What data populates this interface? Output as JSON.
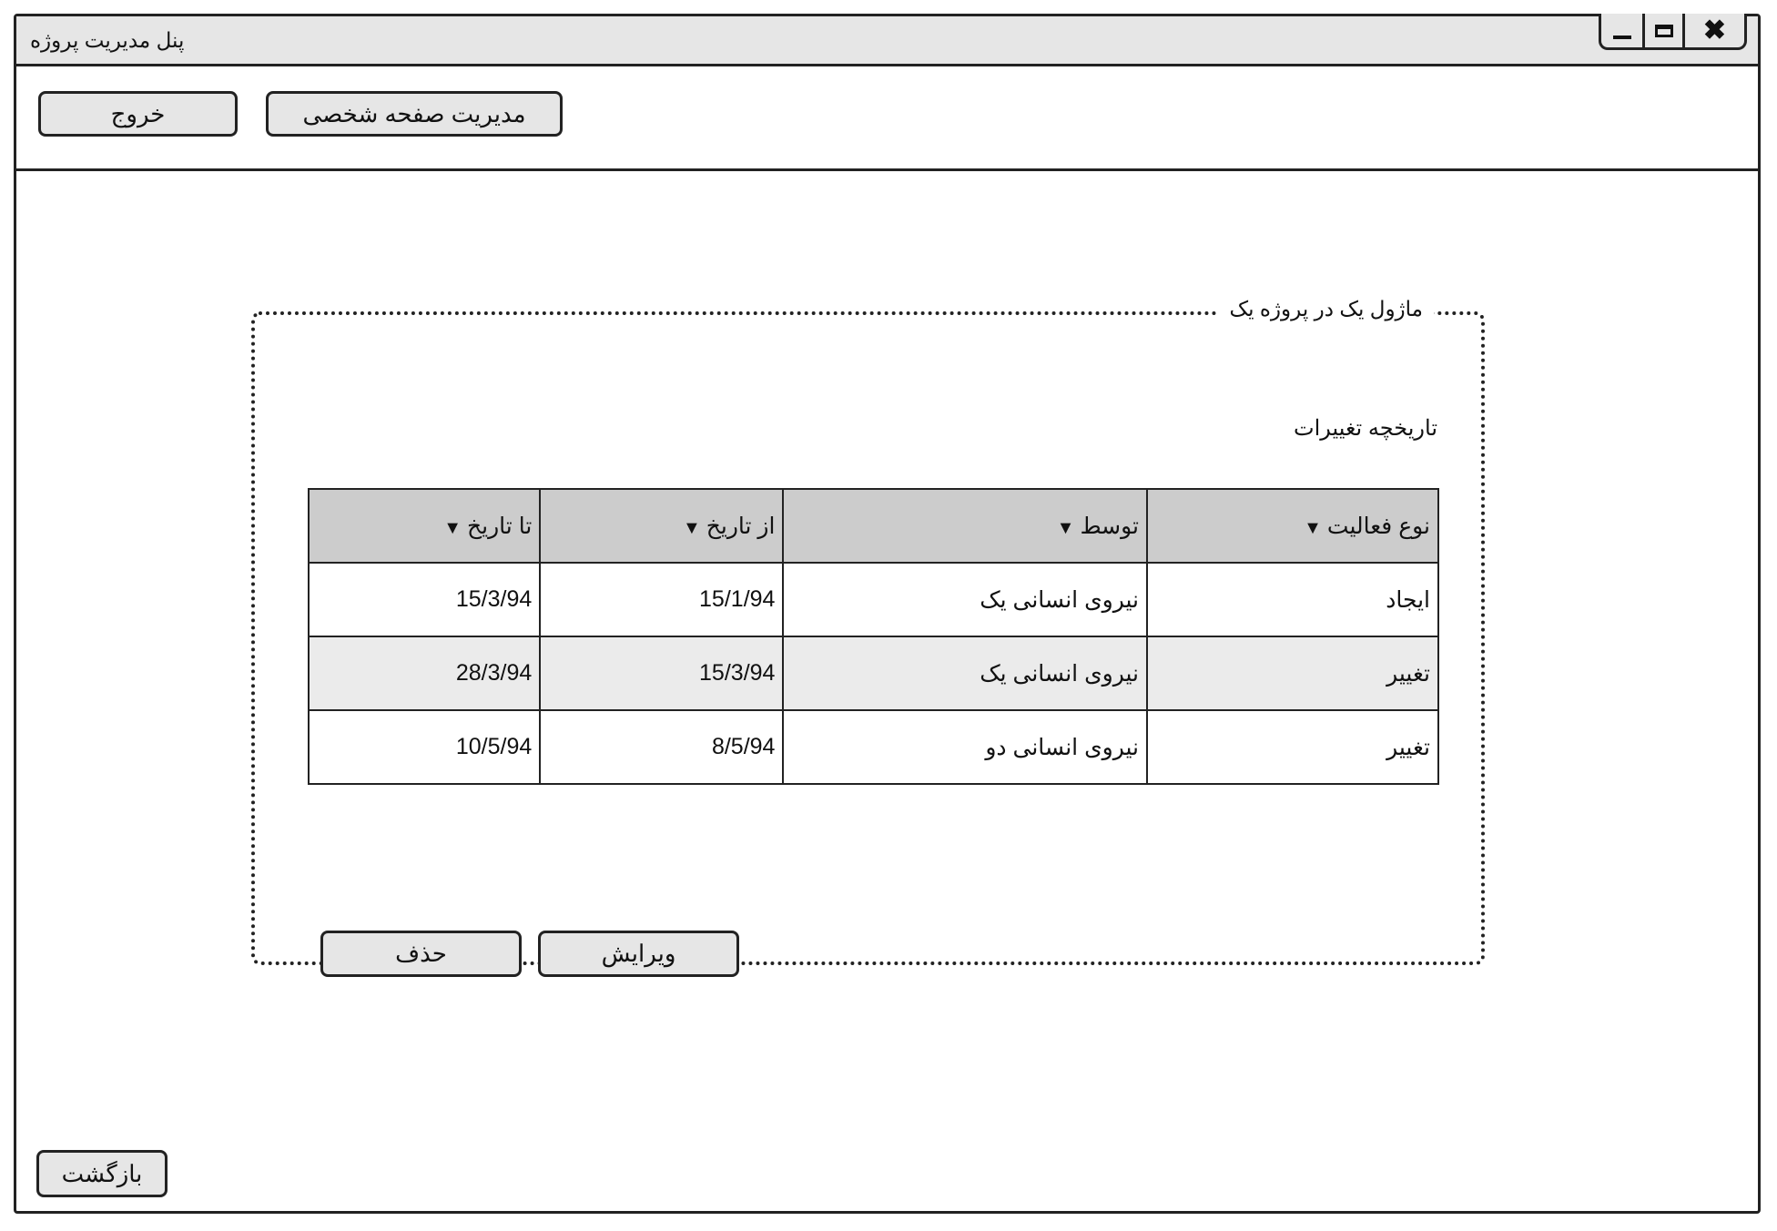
{
  "window": {
    "title": "پنل مدیریت پروژه",
    "controls": {
      "minimize_icon": "minimize-icon",
      "maximize_icon": "maximize-icon",
      "close_icon": "close-icon",
      "close_glyph": "✖"
    }
  },
  "toolbar": {
    "exit_label": "خروج",
    "profile_label": "مدیریت صفحه شخصی"
  },
  "panel": {
    "legend": "ماژول یک در پروژه یک",
    "section_title": "تاریخچه تغییرات",
    "table": {
      "columns": [
        {
          "label": "نوع فعالیت",
          "icon": "sort-down-icon"
        },
        {
          "label": "توسط",
          "icon": "sort-down-icon"
        },
        {
          "label": "از تاریخ",
          "icon": "sort-down-icon"
        },
        {
          "label": "تا تاریخ",
          "icon": "sort-down-icon"
        }
      ],
      "sort_glyph": "▼",
      "rows": [
        {
          "activity": "ایجاد",
          "by": "نیروی انسانی یک",
          "from": "15/1/94",
          "to": "15/3/94"
        },
        {
          "activity": "تغییر",
          "by": "نیروی انسانی یک",
          "from": "15/3/94",
          "to": "28/3/94"
        },
        {
          "activity": "تغییر",
          "by": "نیروی انسانی دو",
          "from": "8/5/94",
          "to": "10/5/94"
        }
      ]
    },
    "edit_label": "ویرایش",
    "delete_label": "حذف"
  },
  "footer": {
    "back_label": "بازگشت"
  },
  "colors": {
    "titlebar": "#e6e6e6",
    "header_row": "#cccccc",
    "alt_row": "#ebebeb",
    "button": "#e6e6e6",
    "border": "#222222"
  }
}
